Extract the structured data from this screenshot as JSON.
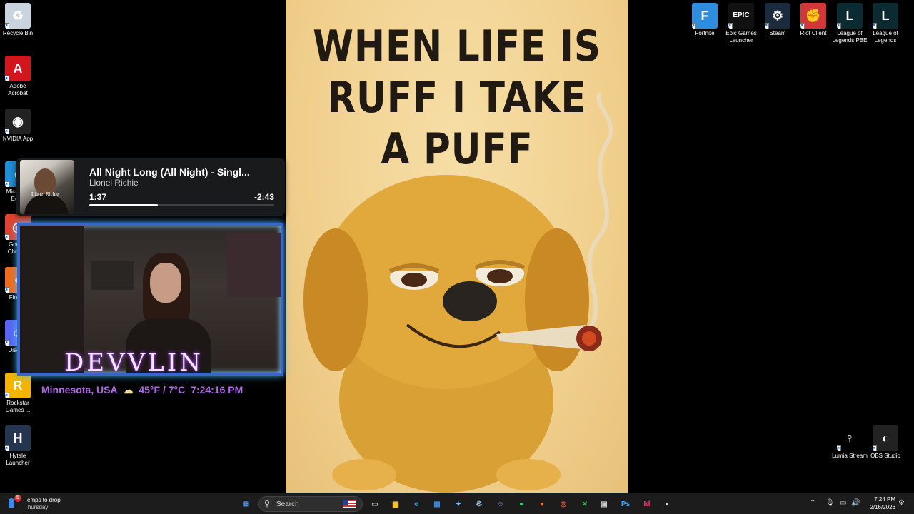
{
  "desktop_icons_left": [
    {
      "label": "Recycle Bin",
      "icon": "recycle-bin-icon",
      "color": "#c9d4de",
      "glyph": "♻"
    },
    {
      "label": "Adobe Acrobat",
      "icon": "adobe-acrobat-icon",
      "color": "#d2161e",
      "glyph": "A"
    },
    {
      "label": "NVIDIA App",
      "icon": "nvidia-icon",
      "color": "#222",
      "glyph": "◉"
    },
    {
      "label": "Microsoft Edge",
      "icon": "edge-icon",
      "color": "#1f8fd6",
      "glyph": "e"
    },
    {
      "label": "Google Chrome",
      "icon": "chrome-icon",
      "color": "#e0432f",
      "glyph": "◎"
    },
    {
      "label": "Firefox",
      "icon": "firefox-icon",
      "color": "#f26a1b",
      "glyph": "●"
    },
    {
      "label": "Discord",
      "icon": "discord-icon",
      "color": "#5865f2",
      "glyph": "☺"
    },
    {
      "label": "Rockstar Games ...",
      "icon": "rockstar-icon",
      "color": "#f4b400",
      "glyph": "R"
    },
    {
      "label": "Hytale Launcher",
      "icon": "hytale-icon",
      "color": "#24364f",
      "glyph": "H"
    }
  ],
  "desktop_icons_right": [
    {
      "label": "Fortnite",
      "icon": "fortnite-icon",
      "color": "#2f8de0",
      "glyph": "F"
    },
    {
      "label": "Epic Games Launcher",
      "icon": "epic-games-icon",
      "color": "#111",
      "glyph": "EPIC"
    },
    {
      "label": "Steam",
      "icon": "steam-icon",
      "color": "#1b2a3d",
      "glyph": "⚙"
    },
    {
      "label": "Riot Client",
      "icon": "riot-client-icon",
      "color": "#d13639",
      "glyph": "✊"
    },
    {
      "label": "League of Legends PBE",
      "icon": "league-pbe-icon",
      "color": "#0b2a32",
      "glyph": "L"
    },
    {
      "label": "League of Legends",
      "icon": "league-icon",
      "color": "#0b2a32",
      "glyph": "L"
    }
  ],
  "desktop_icons_bottom_right": [
    {
      "label": "Lumia Stream",
      "icon": "lumia-stream-icon",
      "color": "#000",
      "glyph": "♀"
    },
    {
      "label": "OBS Studio",
      "icon": "obs-studio-icon",
      "color": "#222",
      "glyph": "◐"
    }
  ],
  "poster": {
    "lines": [
      "WHEN LIFE IS",
      "RUFF I TAKE",
      "A PUFF"
    ]
  },
  "media": {
    "title": "All Night Long (All Night) - Singl...",
    "artist": "Lionel Richie",
    "current_time": "1:37",
    "remaining_time": "-2:43",
    "progress": 0.37,
    "album_label": "Lionel Richie"
  },
  "overlay": {
    "name": "DEVVLIN",
    "location": "Minnesota, USA",
    "weather_icon": "☁",
    "temperature": "45°F / 7°C",
    "time": "7:24:16 PM"
  },
  "taskbar": {
    "weather_title": "Temps to drop",
    "weather_sub": "Thursday",
    "weather_badge": "5",
    "search_placeholder": "Search",
    "apps": [
      {
        "name": "start-button",
        "glyph": "⊞",
        "color": "#4aa3ff"
      },
      {
        "name": "task-view-button",
        "glyph": "▭",
        "color": "#bbb"
      },
      {
        "name": "file-explorer-button",
        "glyph": "▆",
        "color": "#f2c12e"
      },
      {
        "name": "edge-button",
        "glyph": "e",
        "color": "#2aa0e0"
      },
      {
        "name": "store-button",
        "glyph": "▦",
        "color": "#3b8be0"
      },
      {
        "name": "copilot-button",
        "glyph": "✦",
        "color": "#7ab8ff"
      },
      {
        "name": "steam-button",
        "glyph": "⚙",
        "color": "#9cc4e8"
      },
      {
        "name": "discord-button",
        "glyph": "☺",
        "color": "#8890ff"
      },
      {
        "name": "spotify-button",
        "glyph": "●",
        "color": "#1ed760"
      },
      {
        "name": "firefox-button",
        "glyph": "●",
        "color": "#ff7b1a"
      },
      {
        "name": "chrome-button",
        "glyph": "◎",
        "color": "#e8503a"
      },
      {
        "name": "xbox-button",
        "glyph": "✕",
        "color": "#3fbf4f"
      },
      {
        "name": "app-button",
        "glyph": "▣",
        "color": "#ccc"
      },
      {
        "name": "photoshop-button",
        "glyph": "Ps",
        "color": "#31a8ff"
      },
      {
        "name": "indesign-button",
        "glyph": "Id",
        "color": "#ff3366"
      },
      {
        "name": "obs-button",
        "glyph": "◐",
        "color": "#ddd"
      }
    ],
    "time": "7:24 PM",
    "date": "2/16/2026"
  }
}
